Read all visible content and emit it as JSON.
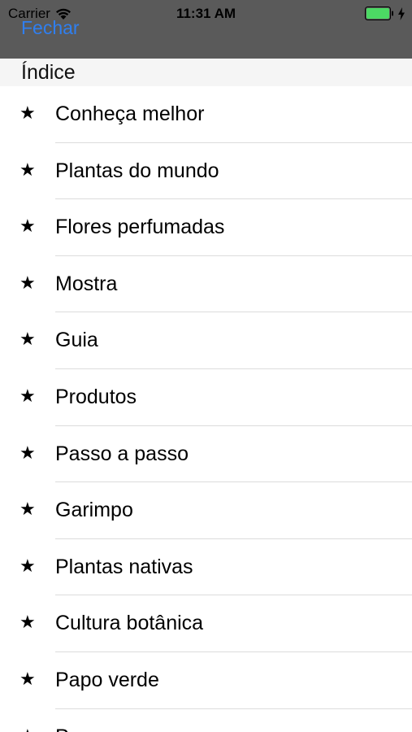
{
  "status_bar": {
    "carrier": "Carrier",
    "time": "11:31 AM",
    "battery_color": "#4cd964"
  },
  "nav": {
    "close_label": "Fechar",
    "accent_color": "#2f7ff0"
  },
  "section": {
    "title": "Índice"
  },
  "menu": {
    "bullet": "★",
    "items": [
      {
        "label": "Conheça melhor"
      },
      {
        "label": "Plantas do mundo"
      },
      {
        "label": "Flores perfumadas"
      },
      {
        "label": "Mostra"
      },
      {
        "label": "Guia"
      },
      {
        "label": "Produtos"
      },
      {
        "label": "Passo a passo"
      },
      {
        "label": "Garimpo"
      },
      {
        "label": "Plantas nativas"
      },
      {
        "label": "Cultura botânica"
      },
      {
        "label": "Papo verde"
      },
      {
        "label": "Pa..."
      }
    ]
  }
}
